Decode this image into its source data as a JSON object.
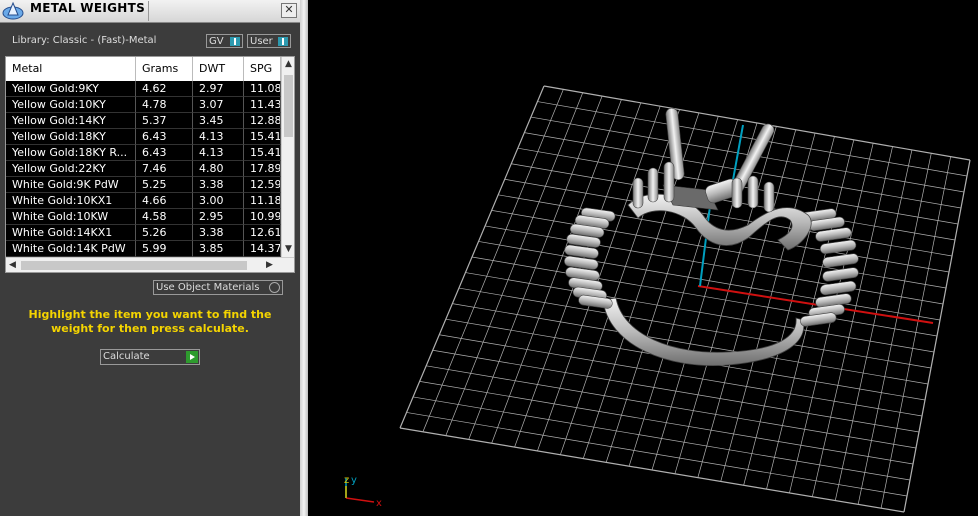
{
  "panel": {
    "title": "METAL WEIGHTS",
    "close_symbol": "✕",
    "library_label": "Library: Classic - (Fast)-Metal",
    "toggles": [
      "GV",
      "User"
    ],
    "columns": [
      "Metal",
      "Grams",
      "DWT",
      "SPG"
    ],
    "rows": [
      [
        "Yellow Gold:9KY",
        "4.62",
        "2.97",
        "11.08"
      ],
      [
        "Yellow Gold:10KY",
        "4.78",
        "3.07",
        "11.43"
      ],
      [
        "Yellow Gold:14KY",
        "5.37",
        "3.45",
        "12.88"
      ],
      [
        "Yellow Gold:18KY",
        "6.43",
        "4.13",
        "15.41"
      ],
      [
        "Yellow Gold:18KY R...",
        "6.43",
        "4.13",
        "15.41"
      ],
      [
        "Yellow Gold:22KY",
        "7.46",
        "4.80",
        "17.89"
      ],
      [
        "White Gold:9K PdW",
        "5.25",
        "3.38",
        "12.59"
      ],
      [
        "White Gold:10KX1",
        "4.66",
        "3.00",
        "11.18"
      ],
      [
        "White Gold:10KW",
        "4.58",
        "2.95",
        "10.99"
      ],
      [
        "White Gold:14KX1",
        "5.26",
        "3.38",
        "12.61"
      ],
      [
        "White Gold:14K PdW",
        "5.99",
        "3.85",
        "14.37"
      ]
    ],
    "use_object_materials_label": "Use Object Materials",
    "hint": "Highlight the item you want to find the weight for then press calculate.",
    "calculate_label": "Calculate"
  },
  "viewport": {
    "axis_labels": {
      "x": "x",
      "y": "y",
      "z": "z"
    },
    "colors": {
      "grid": "#b0b0b0",
      "x_axis": "#d01010",
      "y_axis": "#00a0c0",
      "ring": "#d8d8d8"
    }
  }
}
